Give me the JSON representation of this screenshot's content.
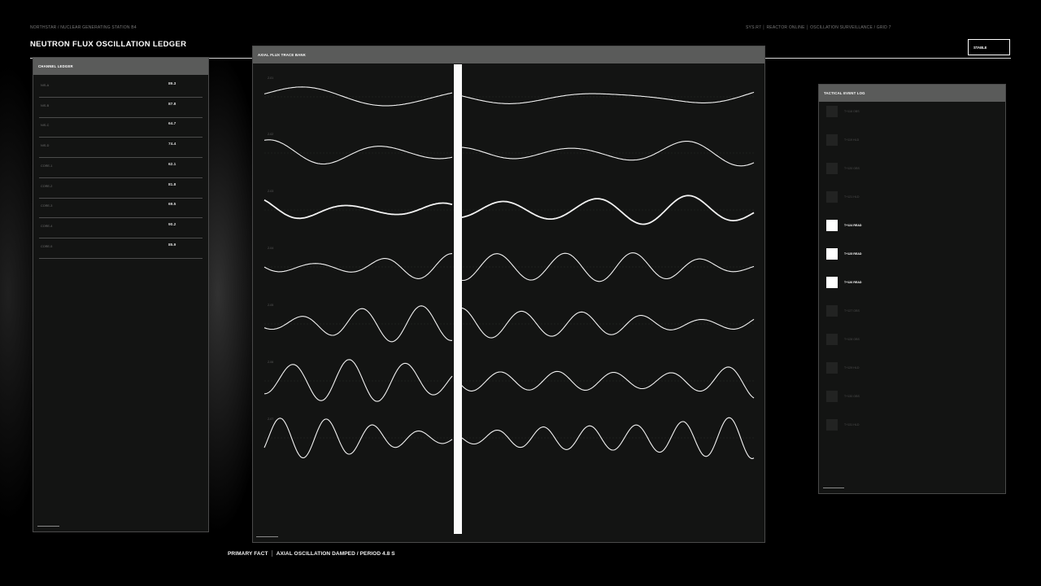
{
  "header": {
    "breadcrumb": "NORTHSTAR / NUCLEAR GENERATING STATION B4",
    "system_status": "SYS.R7 │ REACTOR ONLINE │ OSCILLATION SURVEILLANCE / GRID 7",
    "title": "NEUTRON FLUX OSCILLATION LEDGER",
    "status_label": "STABLE"
  },
  "ledger": {
    "title": "CHANNEL LEDGER",
    "rows": [
      {
        "name": "NIS-A",
        "value": "89.3"
      },
      {
        "name": "NIS-B",
        "value": "87.8"
      },
      {
        "name": "NIS-C",
        "value": "64.7"
      },
      {
        "name": "NIS-D",
        "value": "74.4"
      },
      {
        "name": "CORE-1",
        "value": "62.1"
      },
      {
        "name": "CORE-2",
        "value": "81.8"
      },
      {
        "name": "CORE-3",
        "value": "69.5"
      },
      {
        "name": "CORE-4",
        "value": "90.2"
      },
      {
        "name": "CORE-5",
        "value": "85.9"
      }
    ]
  },
  "traces": {
    "title": "AXIAL FLUX TRACE BANK",
    "rows": [
      {
        "label": "Z-01"
      },
      {
        "label": "Z-02"
      },
      {
        "label": "Z-03"
      },
      {
        "label": "Z-04"
      },
      {
        "label": "Z-05"
      },
      {
        "label": "Z-06"
      },
      {
        "label": "Z-07"
      }
    ]
  },
  "events": {
    "title": "TACTICAL EVENT LOG",
    "items": [
      {
        "label": "T+118 OBS",
        "active": false
      },
      {
        "label": "T+119 HLD",
        "active": false
      },
      {
        "label": "T+120 OBS",
        "active": false
      },
      {
        "label": "T+121 HLD",
        "active": false
      },
      {
        "label": "T+124 READ",
        "active": true
      },
      {
        "label": "T+125 READ",
        "active": true
      },
      {
        "label": "T+126 READ",
        "active": true
      },
      {
        "label": "T+127 OBS",
        "active": false
      },
      {
        "label": "T+128 OBS",
        "active": false
      },
      {
        "label": "T+129 HLD",
        "active": false
      },
      {
        "label": "T+130 OBS",
        "active": false
      },
      {
        "label": "T+131 HLD",
        "active": false
      }
    ]
  },
  "footer": {
    "fact_label": "PRIMARY FACT",
    "fact_text": "AXIAL OSCILLATION DAMPED / PERIOD 4.8 S"
  }
}
